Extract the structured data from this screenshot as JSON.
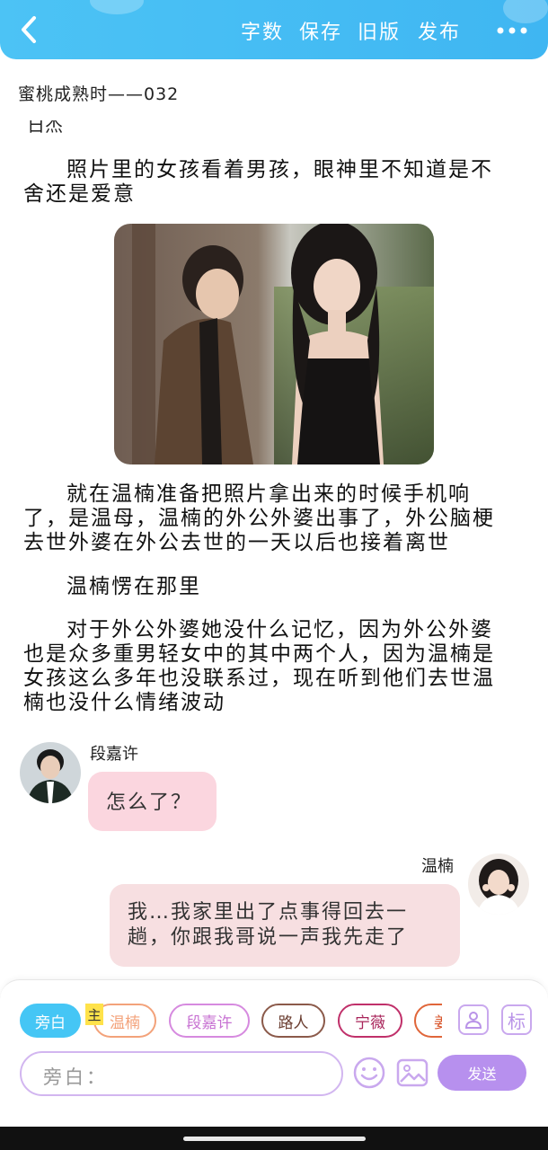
{
  "colors": {
    "topbar": "#45bdf4",
    "accent_purple": "#b790ee",
    "chip_active": "#45c6f5",
    "bubble_left": "#fbd6df",
    "bubble_right": "#f7dfe1"
  },
  "header": {
    "back_icon": "chevron-left-icon",
    "actions": [
      "字数",
      "保存",
      "旧版",
      "发布"
    ],
    "more_icon": "more-dots-icon"
  },
  "chapter": {
    "title": "蜜桃成熟时——032",
    "cut_line": "日杰"
  },
  "paragraphs": [
    "照片里的女孩看着男孩，眼神里不知道是不舍还是爱意",
    "就在温楠准备把照片拿出来的时候手机响了，是温母，温楠的外公外婆出事了，外公脑梗去世外婆在外公去世的一天以后也接着离世",
    "温楠愣在那里",
    "对于外公外婆她没什么记忆，因为外公外婆也是众多重男轻女中的其中两个人，因为温楠是女孩这么多年也没联系过，现在听到他们去世温楠也没什么情绪波动"
  ],
  "chat": {
    "left": {
      "name": "段嘉许",
      "message": "怎么了？"
    },
    "right": {
      "name": "温楠",
      "message": "我…我家里出了点事得回去一趟，你跟我哥说一声我先走了"
    }
  },
  "composer": {
    "chips": [
      {
        "label": "旁白",
        "color": "#45c6f5",
        "active": true
      },
      {
        "label": "温楠",
        "color": "#f3a27a",
        "active": false
      },
      {
        "label": "段嘉许",
        "color": "#d68adf",
        "active": false
      },
      {
        "label": "路人",
        "color": "#8b5a4a",
        "active": false
      },
      {
        "label": "宁薇",
        "color": "#c0306a",
        "active": false
      },
      {
        "label": "姜",
        "color": "#e0663a",
        "active": false
      }
    ],
    "main_badge": "主",
    "tag_icon_label": "标",
    "input_placeholder": "旁白：",
    "send_label": "发送"
  }
}
